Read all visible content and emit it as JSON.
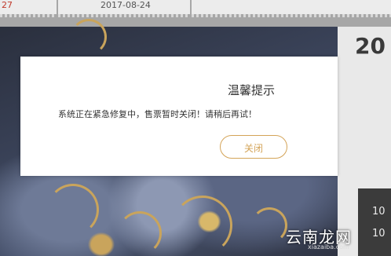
{
  "tabs": {
    "left_fragment": "27",
    "date": "2017-08-24"
  },
  "right_panel": {
    "big_number": "20",
    "small_1": "10",
    "small_2": "10"
  },
  "modal": {
    "title": "温馨提示",
    "message": "系统正在紧急修复中，售票暂时关闭！请稍后再试！",
    "close_label": "关闭",
    "accent_color": "#d4a458"
  },
  "watermark": {
    "text": "云南龙网",
    "sub": "xiazaiba.com"
  }
}
